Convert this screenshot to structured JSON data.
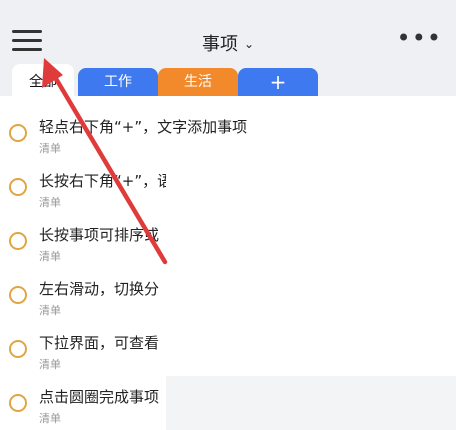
{
  "header": {
    "title": "事项",
    "title_chevron": "⌄",
    "more": "•••"
  },
  "tabs": [
    {
      "label": "全部"
    },
    {
      "label": "工作",
      "color": "#3e79f0"
    },
    {
      "label": "生活",
      "color": "#f28a2c"
    },
    {
      "label": "+",
      "color": "#3e79f0"
    }
  ],
  "items": [
    {
      "title": "轻点右下角“+”，文字添加事项",
      "sub": "清单"
    },
    {
      "title": "长按右下角“+”，语",
      "sub": "清单"
    },
    {
      "title": "长按事项可排序或",
      "sub": "清单"
    },
    {
      "title": "左右滑动，切换分",
      "sub": "清单"
    },
    {
      "title": "下拉界面，可查看",
      "sub": "清单"
    },
    {
      "title": "点击圆圈完成事项",
      "sub": "清单"
    }
  ],
  "colors": {
    "accent_blue": "#3e79f0",
    "accent_orange": "#f28a2c",
    "circle": "#e1a544",
    "annotation_arrow": "#e03b3b"
  }
}
